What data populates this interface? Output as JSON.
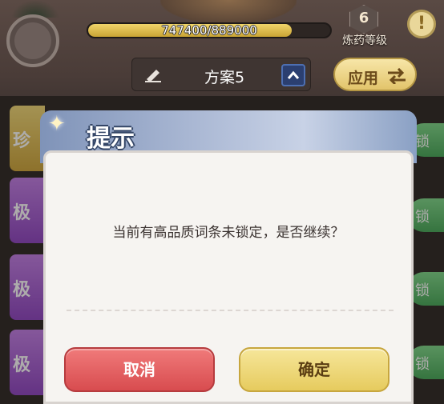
{
  "hud": {
    "xp_text": "747400/889000",
    "xp_progress": 0.8407,
    "level": "6",
    "level_label": "炼药等级",
    "info_symbol": "!"
  },
  "plan": {
    "label": "方案5",
    "apply_label": "应用"
  },
  "side_tabs": [
    "珍",
    "极",
    "极",
    "极"
  ],
  "lock_label": "锁",
  "dialog": {
    "title": "提示",
    "message": "当前有高品质词条未锁定，是否继续？",
    "cancel_label": "取消",
    "confirm_label": "确定"
  },
  "colors": {
    "cancel": "#d84c4f",
    "confirm": "#e6cb5e",
    "lock": "#48a95a",
    "rare_gold": "#cfa63c",
    "rare_purple": "#8f45c2"
  }
}
